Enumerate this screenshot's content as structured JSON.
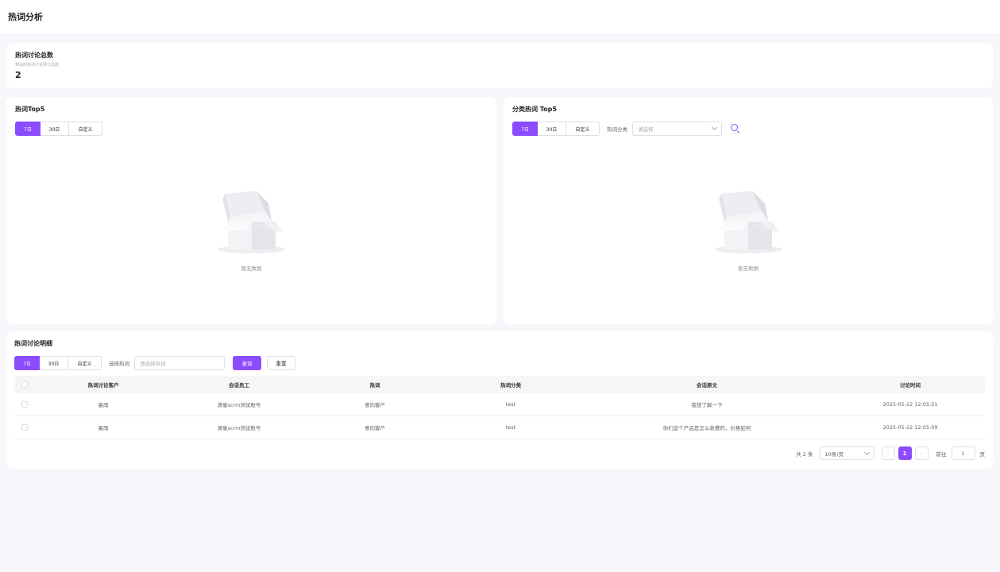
{
  "page": {
    "title": "热词分析"
  },
  "stat": {
    "title": "热词讨论总数",
    "subtitle": "带设的热词讨论累计总数",
    "value": "2"
  },
  "top5": {
    "title": "热词Top5",
    "ranges": [
      "7日",
      "30日",
      "自定义"
    ],
    "active_range": "7日",
    "empty_text": "暂无数据"
  },
  "category_top5": {
    "title": "分类热词 Top5",
    "ranges": [
      "7日",
      "30日",
      "自定义"
    ],
    "active_range": "7日",
    "category_label": "热词分类",
    "category_placeholder": "请选择",
    "empty_text": "暂无数据",
    "search_icon": "search-icon"
  },
  "detail": {
    "title": "热词讨论明细",
    "ranges": [
      "7日",
      "30日",
      "自定义"
    ],
    "active_range": "7日",
    "keyword_label": "选择热词",
    "keyword_placeholder": "请选择热词",
    "query_label": "查询",
    "reset_label": "重置",
    "columns": [
      "热词讨论客户",
      "会话员工",
      "热词",
      "热词分类",
      "会话原文",
      "讨论时间"
    ],
    "rows": [
      [
        "墨雨",
        "源雀scrm测试账号",
        "意向客户",
        "test",
        "我想了解一下",
        "2025-05-22 12:05:21"
      ],
      [
        "墨雨",
        "源雀scrm测试账号",
        "意向客户",
        "test",
        "你们这个产品是怎么收费的，价格如何",
        "2025-05-22 12:05:09"
      ]
    ]
  },
  "pagination": {
    "total_text": "共 2 条",
    "page_size": "10条/页",
    "current_page": "1",
    "goto_label": "前往",
    "goto_value": "1",
    "page_suffix": "页",
    "prev": "‹",
    "next": "›"
  },
  "colors": {
    "accent": "#8c4bff",
    "background": "#f7f7fb"
  }
}
